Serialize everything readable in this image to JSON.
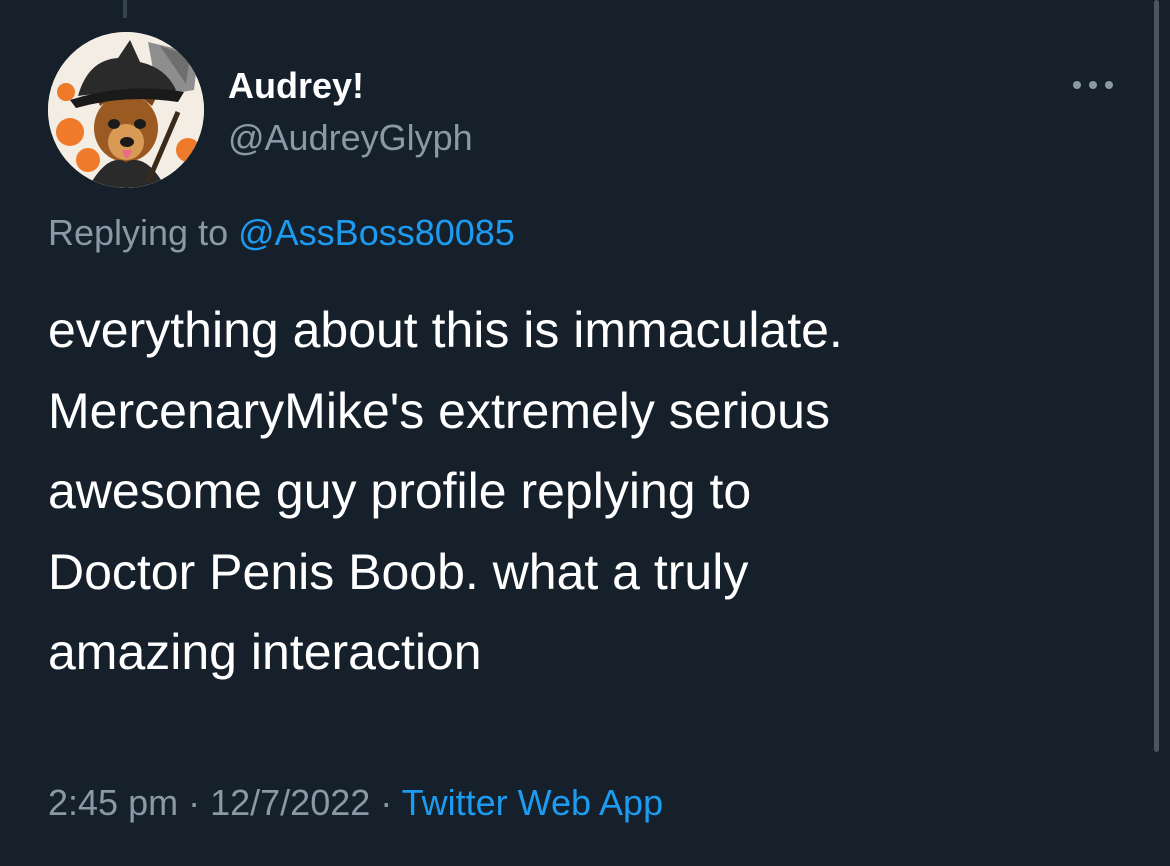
{
  "tweet": {
    "author": {
      "display_name": "Audrey!",
      "handle": "@AudreyGlyph",
      "avatar_icon": "avatar-dog-witch-hat-icon"
    },
    "more_icon": "more-horizontal-icon",
    "replying": {
      "prefix": "Replying to",
      "mention": "@AssBoss80085"
    },
    "text_lines": [
      "everything about this is immaculate.",
      "MercenaryMike's extremely serious",
      "awesome guy profile replying to",
      "Doctor Penis Boob. what a truly",
      "amazing interaction"
    ],
    "meta": {
      "time": "2:45 pm",
      "separator1": "·",
      "date": "12/7/2022",
      "separator2": "·",
      "source": "Twitter Web App"
    }
  },
  "colors": {
    "background": "#15202b",
    "text": "#ffffff",
    "secondary_text": "#8b98a5",
    "accent": "#1d9bf0"
  }
}
